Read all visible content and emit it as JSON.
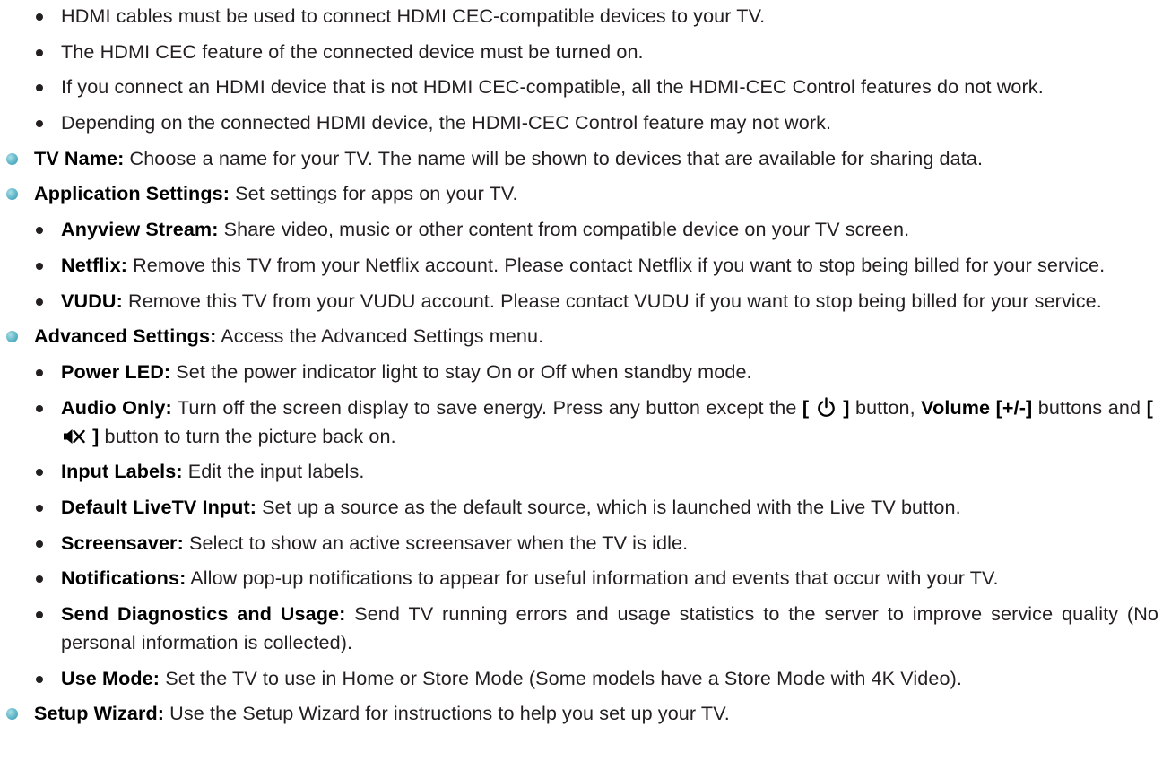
{
  "items": [
    {
      "level": 2,
      "term": "",
      "text": "HDMI cables must be used to connect HDMI CEC-compatible devices to your TV."
    },
    {
      "level": 2,
      "term": "",
      "text": "The HDMI CEC feature of the connected device must be turned on."
    },
    {
      "level": 2,
      "term": "",
      "text": "If you connect an HDMI device that is not HDMI CEC-compatible, all the HDMI-CEC Control features do not work."
    },
    {
      "level": 2,
      "term": "",
      "text": "Depending on the connected HDMI device, the HDMI-CEC Control feature may not work."
    },
    {
      "level": 1,
      "term": "TV Name:",
      "text": " Choose a name for your TV. The name will be shown to devices that are available for sharing data."
    },
    {
      "level": 1,
      "term": "Application Settings:",
      "text": " Set settings for apps on your TV."
    },
    {
      "level": 2,
      "term": "Anyview Stream:",
      "text": " Share video, music or other content from compatible device on your TV screen."
    },
    {
      "level": 2,
      "term": "Netflix:",
      "text": " Remove this TV from your Netflix account. Please contact Netflix if you want to stop being billed for your service."
    },
    {
      "level": 2,
      "term": "VUDU:",
      "text": " Remove this TV from your VUDU account. Please contact VUDU if you want to stop being billed for your service."
    },
    {
      "level": 1,
      "term": "Advanced Settings:",
      "text": " Access the Advanced Settings menu."
    },
    {
      "level": 2,
      "term": "Power LED:",
      "text": " Set the power indicator light to stay On or Off when standby mode."
    },
    {
      "level": 2,
      "term": "Audio Only:",
      "text_a": " Turn off the screen display to save energy. Press any button except the ",
      "power_open": "[",
      "power_close": "]",
      "text_b": " button, ",
      "volume_label": "Volume [+/-]",
      "text_c": " buttons and ",
      "mute_open": "[",
      "mute_close": "]",
      "text_d": " button to turn the picture back on.",
      "power_icon": "power-icon",
      "mute_icon": "mute-icon"
    },
    {
      "level": 2,
      "term": "Input Labels:",
      "text": " Edit the input labels."
    },
    {
      "level": 2,
      "term": "Default LiveTV Input:",
      "text": " Set up a source as the default source, which is launched with the Live TV button."
    },
    {
      "level": 2,
      "term": "Screensaver:",
      "text": " Select to show an active screensaver when the TV is idle."
    },
    {
      "level": 2,
      "term": "Notifications:",
      "text": " Allow pop-up notifications to appear for useful information and events that occur with your TV."
    },
    {
      "level": 2,
      "term": "Send Diagnostics and Usage:",
      "text": " Send TV running errors and usage statistics to the server to improve service quality (No personal information is collected)."
    },
    {
      "level": 2,
      "term": "Use Mode:",
      "text": " Set the TV to use in Home or Store Mode (Some models have a Store Mode with 4K Video)."
    },
    {
      "level": 1,
      "term": "Setup Wizard:",
      "text": " Use the Setup Wizard for instructions to help you set up your TV."
    }
  ],
  "colors": {
    "text": "#231f20",
    "term": "#000000",
    "level1_bullet": "#5fb6c8"
  }
}
